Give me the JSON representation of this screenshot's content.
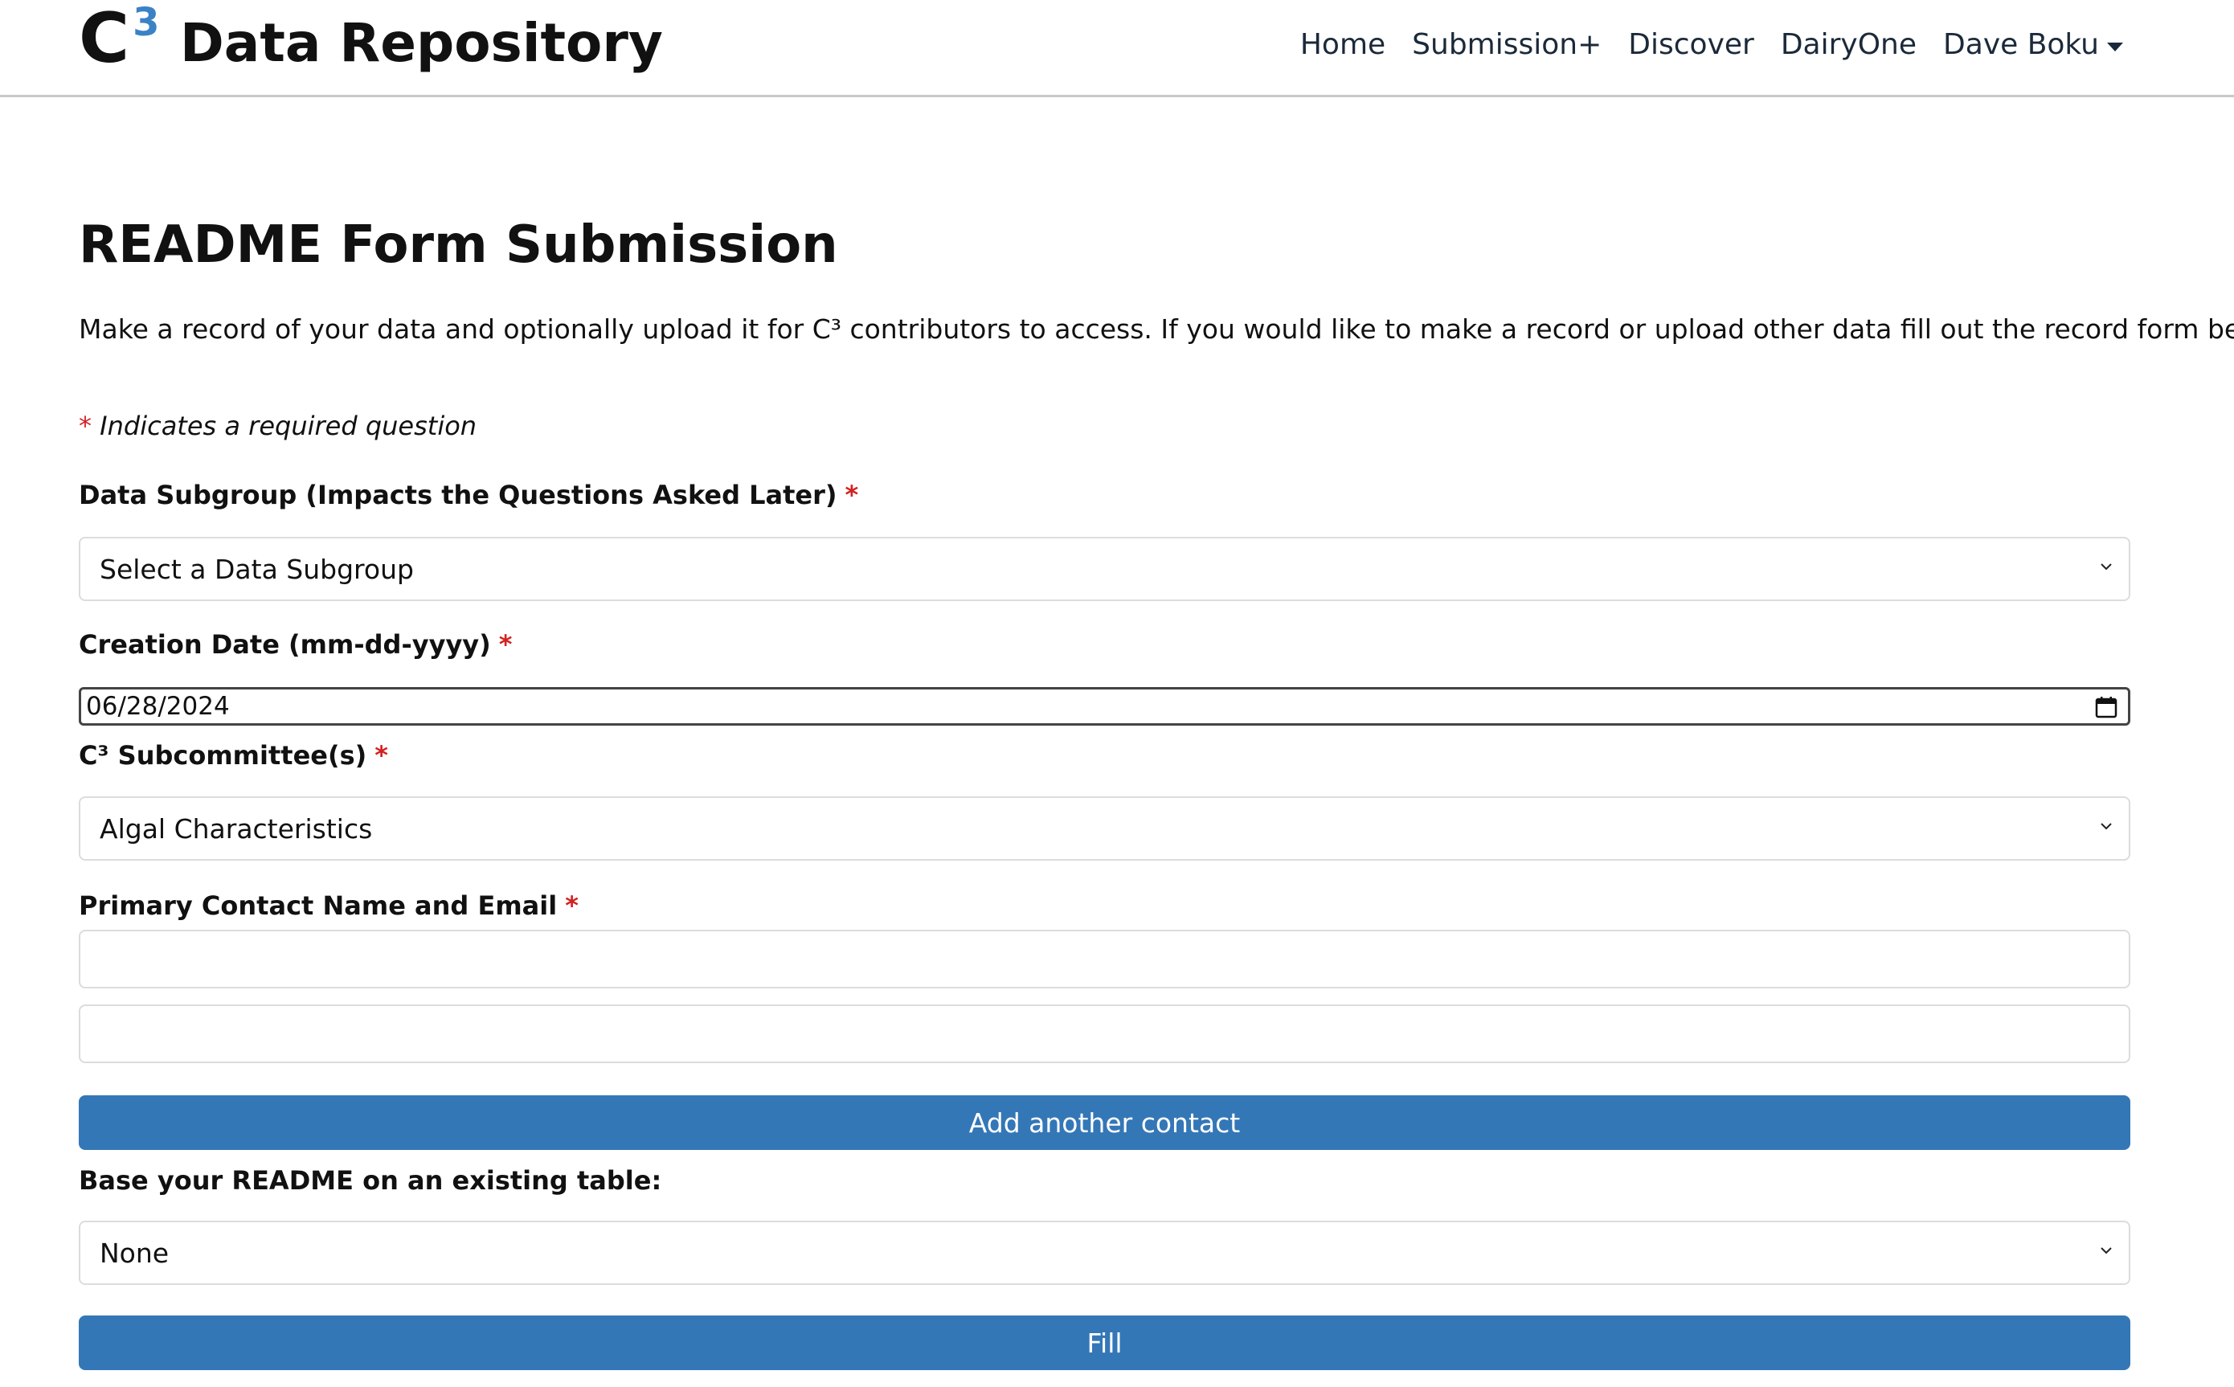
{
  "header": {
    "logo_letter": "C",
    "logo_superscript": "3",
    "logo_text": "Data Repository",
    "nav": {
      "home": "Home",
      "submission": "Submission+",
      "discover": "Discover",
      "dairyone": "DairyOne",
      "user": "Dave Boku"
    }
  },
  "page": {
    "title": "README Form Submission",
    "intro": "Make a record of your data and optionally upload it for C³ contributors to access. If you would like to make a record or upload other data fill out the record form below.",
    "required_star": "*",
    "required_note": "Indicates a required question"
  },
  "form": {
    "subgroup": {
      "label": "Data Subgroup (Impacts the Questions Asked Later)",
      "value": "Select a Data Subgroup"
    },
    "creation_date": {
      "label": "Creation Date (mm-dd-yyyy)",
      "value": "06/28/2024"
    },
    "subcommittee": {
      "label": "C³ Subcommittee(s)",
      "value": "Algal Characteristics"
    },
    "contact": {
      "label": "Primary Contact Name and Email",
      "name_value": "",
      "email_value": "",
      "add_button": "Add another contact"
    },
    "base_table": {
      "label": "Base your README on an existing table:",
      "value": "None",
      "fill_button": "Fill"
    }
  },
  "colors": {
    "accent": "#3477b7",
    "logo_accent": "#3a82c6",
    "required": "#d42121"
  }
}
